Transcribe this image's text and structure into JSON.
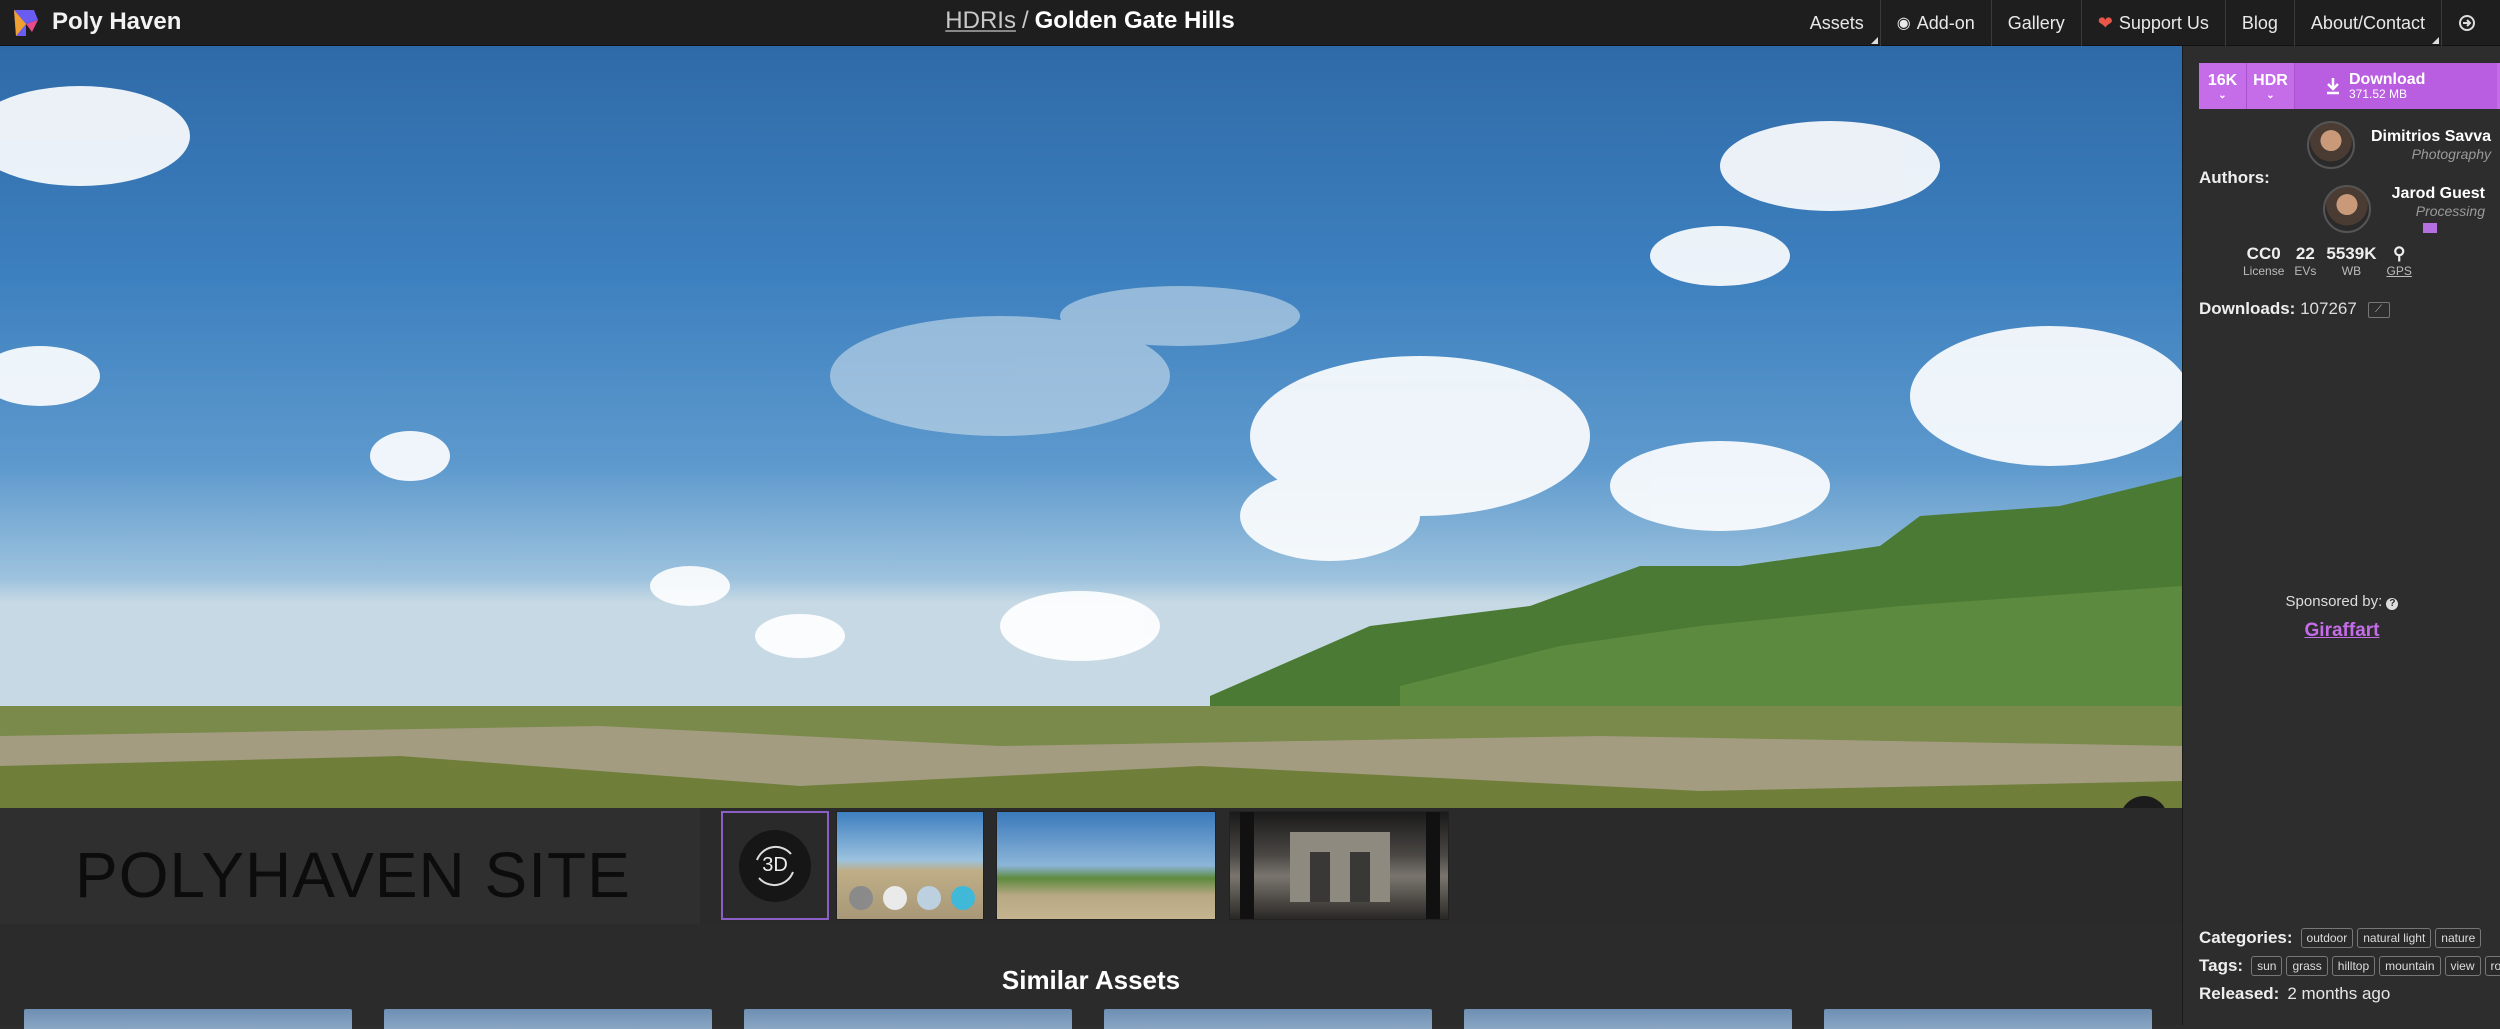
{
  "header": {
    "site_name": "Poly Haven",
    "breadcrumb_category": "HDRIs",
    "breadcrumb_separator": "/",
    "asset_name": "Golden Gate Hills",
    "nav": [
      "Assets",
      "Add-on",
      "Gallery",
      "Support Us",
      "Blog",
      "About/Contact"
    ]
  },
  "preview": {
    "promo_text": "POLYHAVEN SITE",
    "thumb_3d_label": "3D"
  },
  "similar": {
    "title": "Similar Assets"
  },
  "download": {
    "resolution": "16K",
    "format": "HDR",
    "label": "Download",
    "size": "371.52 MB"
  },
  "authors": {
    "label": "Authors:",
    "list": [
      {
        "name": "Dimitrios Savva",
        "role": "Photography"
      },
      {
        "name": "Jarod Guest",
        "role": "Processing"
      }
    ]
  },
  "stats": [
    {
      "value": "CC0",
      "label": "License"
    },
    {
      "value": "22",
      "label": "EVs"
    },
    {
      "value": "5539K",
      "label": "WB"
    },
    {
      "value": "",
      "label": "GPS"
    }
  ],
  "downloads": {
    "label": "Downloads:",
    "count": "107267"
  },
  "sponsor": {
    "label": "Sponsored by:",
    "name": "Giraffart"
  },
  "categories": {
    "label": "Categories:",
    "items": [
      "outdoor",
      "natural light",
      "nature"
    ]
  },
  "tags": {
    "label": "Tags:",
    "items": [
      "sun",
      "grass",
      "hilltop",
      "mountain",
      "view",
      "ro"
    ]
  },
  "released": {
    "label": "Released:",
    "value": "2 months ago"
  },
  "colors": {
    "accent": "#c56ce9",
    "topbar": "#1e1e1e",
    "sidebar": "#2d2d2d"
  }
}
